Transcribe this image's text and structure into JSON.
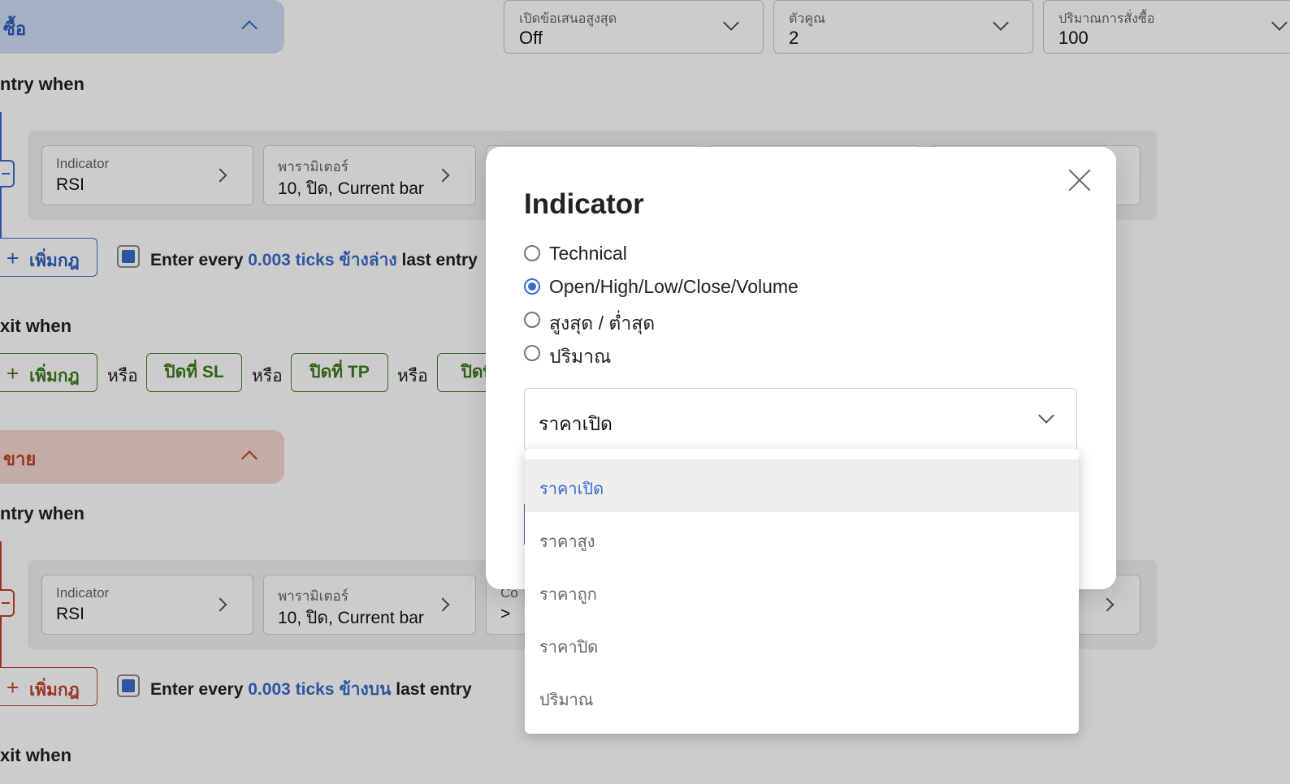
{
  "buy": {
    "title": "ซื้อ",
    "entry_heading": "ntry when",
    "exit_heading": "xit when",
    "rule": {
      "indicator_label": "Indicator",
      "indicator_value": "RSI",
      "param_label": "พารามิเตอร์",
      "param_value": "10, ปิด, Current bar"
    },
    "add_rule": "เพิ่มกฎ",
    "entry_text": {
      "prefix": "Enter every ",
      "highlight": "0.003 ticks ข้างล่าง",
      "suffix": " last entry"
    },
    "exit_row": {
      "or": "หรือ",
      "close_sl": "ปิดที่ SL",
      "close_tp": "ปิดที่ TP",
      "close_other": "ปิดที่"
    }
  },
  "top_selects": [
    {
      "label": "เปิดข้อเสนอสูงสุด",
      "value": "Off"
    },
    {
      "label": "ตัวคูณ",
      "value": "2"
    },
    {
      "label": "ปริมาณการสั่งซื้อ",
      "value": "100"
    }
  ],
  "sell": {
    "title": "ขาย",
    "entry_heading": "ntry when",
    "exit_heading": "xit when",
    "rule": {
      "indicator_label": "Indicator",
      "indicator_value": "RSI",
      "param_label": "พารามิเตอร์",
      "param_value": "10, ปิด, Current bar",
      "cond_label": "Co",
      "cond_value": ">"
    },
    "add_rule": "เพิ่มกฎ",
    "entry_text": {
      "prefix": "Enter every ",
      "highlight": "0.003 ticks ข้างบน",
      "suffix": " last entry"
    }
  },
  "modal": {
    "title": "Indicator",
    "options": [
      {
        "label": "Technical",
        "selected": false
      },
      {
        "label": "Open/High/Low/Close/Volume",
        "selected": true
      },
      {
        "label": "สูงสุด / ต่ำสุด",
        "selected": false
      },
      {
        "label": "ปริมาณ",
        "selected": false
      }
    ],
    "select_value": "ราคาเปิด",
    "dropdown_items": [
      "ราคาเปิด",
      "ราคาสูง",
      "ราคาถูก",
      "ราคาปิด",
      "ปริมาณ"
    ],
    "dropdown_selected": "ราคาเปิด"
  },
  "colors": {
    "primary": "#3a6cc9",
    "buy_bg": "#cfdcf3",
    "sell_bg": "#f6d7d0",
    "sell_accent": "#c0432b",
    "green": "#3f7a1e"
  }
}
